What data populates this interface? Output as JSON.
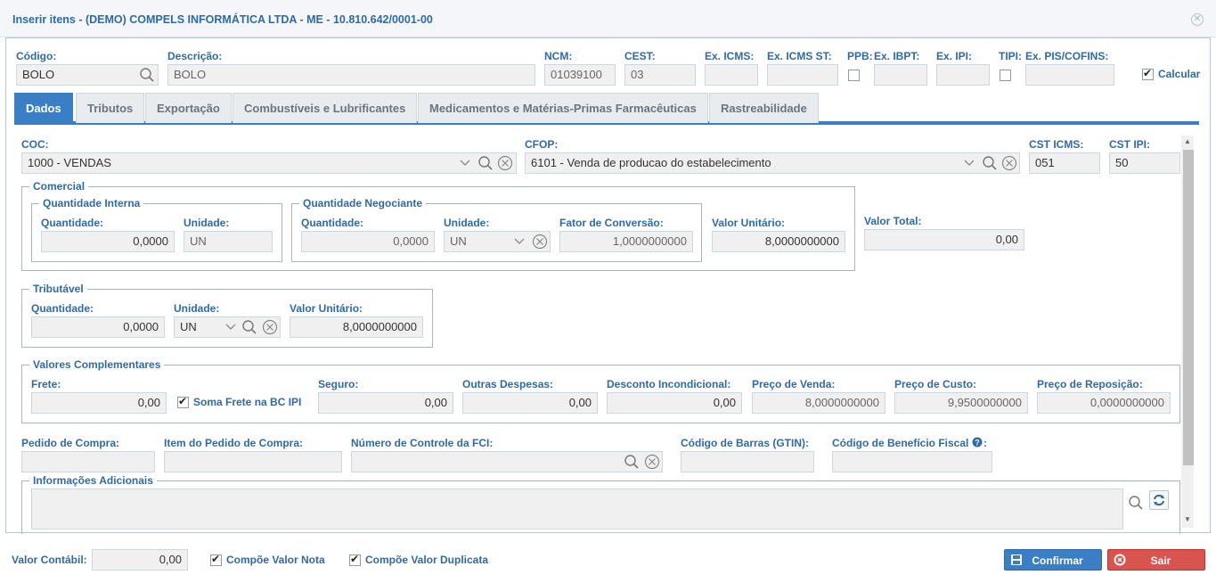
{
  "window": {
    "title": "Inserir itens - (DEMO) COMPELS INFORMÁTICA LTDA - ME - 10.810.642/0001-00"
  },
  "header": {
    "codigo_label": "Código:",
    "codigo_value": "BOLO",
    "descricao_label": "Descrição:",
    "descricao_value": "BOLO",
    "ncm_label": "NCM:",
    "ncm_value": "01039100",
    "cest_label": "CEST:",
    "cest_value": "03",
    "ex_icms_label": "Ex. ICMS:",
    "ex_icms_st_label": "Ex. ICMS ST:",
    "ppb_label": "PPB:",
    "ex_ibpt_label": "Ex. IBPT:",
    "ex_ipi_label": "Ex. IPI:",
    "tipi_label": "TIPI:",
    "ex_pis_cofins_label": "Ex. PIS/COFINS:",
    "calcular_label": "Calcular"
  },
  "tabs": [
    {
      "label": "Dados"
    },
    {
      "label": "Tributos"
    },
    {
      "label": "Exportação"
    },
    {
      "label": "Combustíveis e Lubrificantes"
    },
    {
      "label": "Medicamentos e Matérias-Primas Farmacêuticas"
    },
    {
      "label": "Rastreabilidade"
    }
  ],
  "dados": {
    "coc_label": "COC:",
    "coc_value": "1000 - VENDAS",
    "cfop_label": "CFOP:",
    "cfop_value": "6101 - Venda de producao do estabelecimento",
    "cst_icms_label": "CST ICMS:",
    "cst_icms_value": "051",
    "cst_ipi_label": "CST IPI:",
    "cst_ipi_value": "50",
    "comercial": {
      "title": "Comercial",
      "interna_title": "Quantidade Interna",
      "quantidade_label": "Quantidade:",
      "quantidade_value": "0,0000",
      "unidade_label": "Unidade:",
      "unidade_value": "UN",
      "negociante_title": "Quantidade Negociante",
      "neg_quantidade_label": "Quantidade:",
      "neg_quantidade_value": "0,0000",
      "neg_unidade_label": "Unidade:",
      "neg_unidade_value": "UN",
      "fator_label": "Fator de Conversão:",
      "fator_value": "1,0000000000",
      "valor_unitario_label": "Valor Unitário:",
      "valor_unitario_value": "8,0000000000",
      "valor_total_label": "Valor Total:",
      "valor_total_value": "0,00"
    },
    "tributavel": {
      "title": "Tributável",
      "quantidade_label": "Quantidade:",
      "quantidade_value": "0,0000",
      "unidade_label": "Unidade:",
      "unidade_value": "UN",
      "valor_unitario_label": "Valor Unitário:",
      "valor_unitario_value": "8,0000000000"
    },
    "complementares": {
      "title": "Valores Complementares",
      "frete_label": "Frete:",
      "frete_value": "0,00",
      "soma_frete_label": "Soma Frete na BC IPI",
      "seguro_label": "Seguro:",
      "seguro_value": "0,00",
      "outras_label": "Outras Despesas:",
      "outras_value": "0,00",
      "desconto_label": "Desconto Incondicional:",
      "desconto_value": "0,00",
      "preco_venda_label": "Preço de Venda:",
      "preco_venda_value": "8,0000000000",
      "preco_custo_label": "Preço de Custo:",
      "preco_custo_value": "9,9500000000",
      "preco_reposicao_label": "Preço de Reposição:",
      "preco_reposicao_value": "0,0000000000"
    },
    "pedido_compra_label": "Pedido de Compra:",
    "item_pedido_label": "Item do Pedido de Compra:",
    "fci_label": "Número de Controle da FCI:",
    "gtin_label": "Código de Barras (GTIN):",
    "beneficio_label": "Código de Benefício Fiscal",
    "info_adicionais_title": "Informações Adicionais"
  },
  "footer": {
    "valor_contabil_label": "Valor Contábil:",
    "valor_contabil_value": "0,00",
    "compoe_nota_label": "Compõe Valor Nota",
    "compoe_duplicata_label": "Compõe Valor Duplicata",
    "confirmar_label": "Confirmar",
    "sair_label": "Sair"
  },
  "colors": {
    "accent": "#3a7ec6",
    "label": "#2f6aa8",
    "danger": "#d9534f"
  }
}
